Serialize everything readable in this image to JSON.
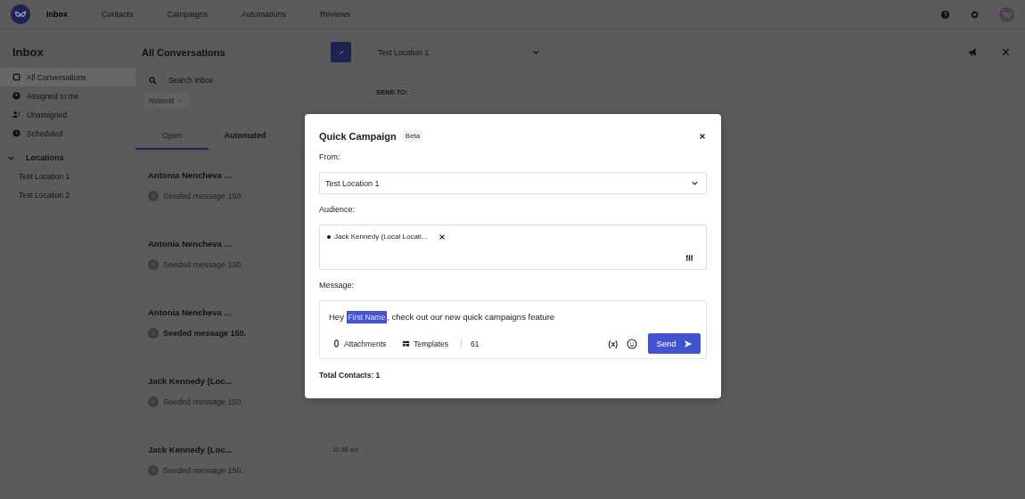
{
  "nav": {
    "items": [
      {
        "label": "Inbox",
        "selected": true
      },
      {
        "label": "Contacts",
        "selected": false
      },
      {
        "label": "Campaigns",
        "selected": false
      },
      {
        "label": "Automations",
        "selected": false
      },
      {
        "label": "Reviews",
        "selected": false
      }
    ],
    "avatar": "TU"
  },
  "sidebar": {
    "title": "Inbox",
    "items": [
      {
        "label": "All Conversations",
        "selected": true
      },
      {
        "label": "Assigned to me",
        "selected": false
      },
      {
        "label": "Unassigned",
        "selected": false
      },
      {
        "label": "Scheduled",
        "selected": false
      }
    ],
    "group": {
      "label": "Locations",
      "expanded": true,
      "children": [
        {
          "label": "Test Location 1"
        },
        {
          "label": "Test Location 2"
        }
      ]
    }
  },
  "conversations": {
    "title": "All Conversations",
    "search": {
      "placeholder": "Search Inbox"
    },
    "sort": "Newest",
    "tabs": [
      {
        "label": "Open",
        "selected": true
      },
      {
        "label": "Automated",
        "selected": false
      }
    ],
    "items": [
      {
        "name": "Antonia Nencheva ...",
        "preview": "Seeded message 150.",
        "unread": false
      },
      {
        "name": "Antonia Nencheva ...",
        "preview": "Seeded message 150.",
        "unread": false
      },
      {
        "name": "Antonia Nencheva ...",
        "preview": "Seeded message 150.",
        "unread": true
      },
      {
        "name": "Jack Kennedy (Loc...",
        "preview": "Seeded message 150.",
        "unread": false
      },
      {
        "name": "Jack Kennedy (Loc...",
        "preview": "Seeded message 150.",
        "unread": false,
        "time": "11:38 am"
      }
    ]
  },
  "detail": {
    "location": "Test Location 1",
    "send_to_label": "SEND TO:"
  },
  "modal": {
    "title": "Quick Campaign",
    "badge": "Beta",
    "from_label": "From:",
    "from_value": "Test Location 1",
    "audience_label": "Audience:",
    "audience": [
      {
        "label": "Jack Kennedy (Local Locati..."
      }
    ],
    "message_label": "Message:",
    "message": {
      "before": "Hey",
      "variable": "First Name",
      "after": ", check out our new quick campaigns feature"
    },
    "attachments": "Attachments",
    "templates": "Templates",
    "count": "61",
    "variables": "(x)",
    "send": "Send",
    "total": "Total Contacts: 1"
  }
}
